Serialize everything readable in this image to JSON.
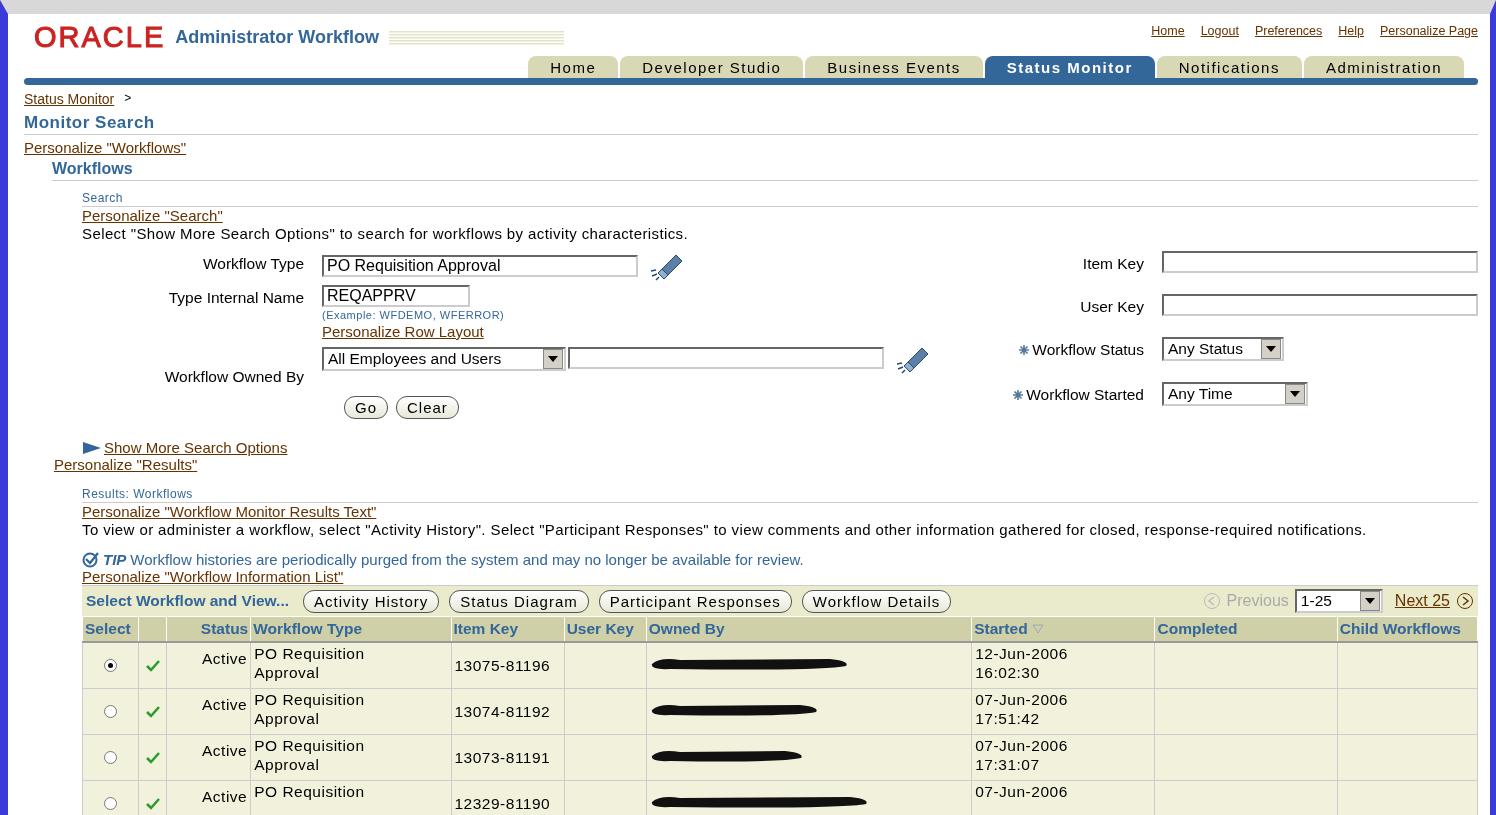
{
  "header": {
    "logo": "ORACLE",
    "app_title": "Administrator Workflow",
    "global_links": [
      "Home",
      "Logout",
      "Preferences",
      "Help",
      "Personalize Page"
    ]
  },
  "tabs": [
    {
      "label": "Home",
      "selected": false
    },
    {
      "label": "Developer Studio",
      "selected": false
    },
    {
      "label": "Business Events",
      "selected": false
    },
    {
      "label": "Status Monitor",
      "selected": true
    },
    {
      "label": "Notifications",
      "selected": false
    },
    {
      "label": "Administration",
      "selected": false
    }
  ],
  "breadcrumbs": [
    {
      "label": "Status Monitor",
      "separator": ">"
    }
  ],
  "page_title": "Monitor Search",
  "personalize_workflows": "Personalize \"Workflows\"",
  "section_title": "Workflows",
  "search": {
    "subheading": "Search",
    "personalize_link": "Personalize \"Search\"",
    "instruction": "Select \"Show More Search Options\" to search for workflows by activity characteristics.",
    "left_fields": [
      {
        "label": "Workflow Type",
        "value": "PO Requisition Approval",
        "kind": "lov"
      },
      {
        "label": "Type Internal Name",
        "value": "REQAPPRV",
        "kind": "text",
        "hint": "(Example: WFDEMO, WFERROR)",
        "link": "Personalize Row Layout"
      },
      {
        "label": "Workflow Owned By",
        "value": "All Employees and Users",
        "kind": "select_lov"
      }
    ],
    "right_fields": [
      {
        "label": "Item Key",
        "kind": "text",
        "required": false
      },
      {
        "label": "User Key",
        "kind": "text",
        "required": false
      },
      {
        "label": "Workflow Status",
        "value": "Any Status",
        "kind": "select",
        "required": true
      },
      {
        "label": "Workflow Started",
        "value": "Any Time",
        "kind": "select",
        "required": true
      }
    ],
    "buttons": [
      "Go",
      "Clear"
    ],
    "more_options": "Show More Search Options"
  },
  "personalize_results": "Personalize \"Results\"",
  "results": {
    "subheading": "Results: Workflows",
    "personalize_link": "Personalize \"Workflow Monitor Results Text\"",
    "description": "To view or administer a workflow, select \"Activity History\". Select \"Participant Responses\" to view comments and other information gathered for closed, response-required notifications.",
    "tip_label": "TIP",
    "tip": "Workflow histories are periodically purged from the system and may no longer be available for review.",
    "personalize_list": "Personalize \"Workflow Information List\""
  },
  "table": {
    "toolbar_label": "Select Workflow and View...",
    "actions": [
      "Activity History",
      "Status Diagram",
      "Participant Responses",
      "Workflow Details"
    ],
    "pager": {
      "previous": "Previous",
      "previous_disabled": true,
      "range": "1-25",
      "next": "Next 25"
    },
    "columns": [
      "Select",
      "Status",
      "Workflow Type",
      "Item Key",
      "User Key",
      "Owned By",
      "Started",
      "Completed",
      "Child Workflows"
    ],
    "rows": [
      {
        "selected": true,
        "status": "Active",
        "workflow_type": "PO Requisition Approval",
        "item_key": "13075-81196",
        "started_date": "12-Jun-2006",
        "started_time": "16:02:30"
      },
      {
        "selected": false,
        "status": "Active",
        "workflow_type": "PO Requisition Approval",
        "item_key": "13074-81192",
        "started_date": "07-Jun-2006",
        "started_time": "17:51:42"
      },
      {
        "selected": false,
        "status": "Active",
        "workflow_type": "PO Requisition Approval",
        "item_key": "13073-81191",
        "started_date": "07-Jun-2006",
        "started_time": "17:31:07"
      },
      {
        "selected": false,
        "status": "Active",
        "workflow_type": "PO Requisition",
        "item_key": "12329-81190",
        "started_date": "07-Jun-2006"
      }
    ]
  }
}
